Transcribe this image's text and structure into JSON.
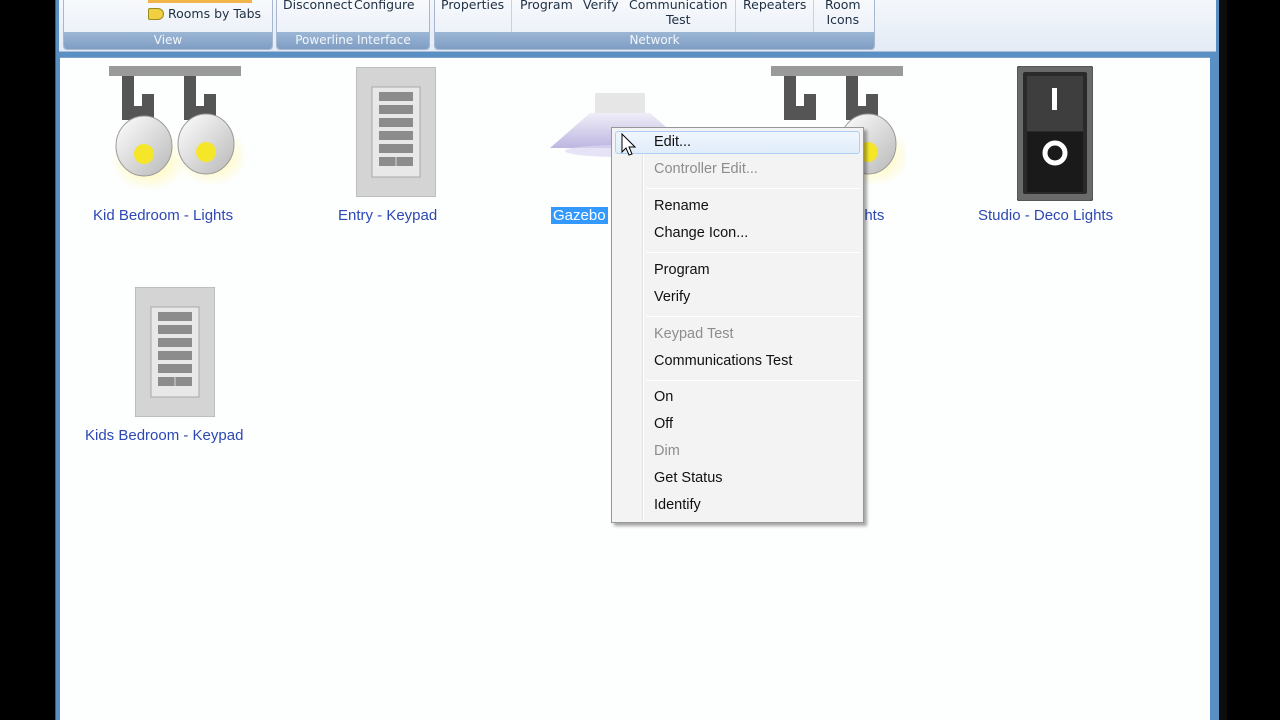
{
  "ribbon": {
    "view": {
      "rooms_by_tabs": "Rooms by Tabs",
      "group_label": "View"
    },
    "powerline": {
      "disconnect": "Disconnect",
      "configure": "Configure",
      "group_label": "Powerline Interface"
    },
    "network": {
      "properties": "Properties",
      "program": "Program",
      "verify": "Verify",
      "communication_l1": "Communication",
      "communication_l2": "Test",
      "repeaters": "Repeaters",
      "room_l1": "Room",
      "room_l2": "Icons",
      "group_label": "Network"
    }
  },
  "devices": [
    {
      "label": "Kid Bedroom - Lights",
      "icon": "track-light-icon"
    },
    {
      "label": "Entry - Keypad",
      "icon": "keypad-icon"
    },
    {
      "label": "Gazebo",
      "icon": "pendant-light-icon",
      "selected": true
    },
    {
      "label": "ghts",
      "icon": "track-light-icon"
    },
    {
      "label": "Studio - Deco Lights",
      "icon": "rocker-switch-icon"
    },
    {
      "label": "Kids Bedroom - Keypad",
      "icon": "keypad-icon"
    }
  ],
  "context_menu": {
    "items": [
      {
        "label": "Edit...",
        "enabled": true,
        "highlighted": true
      },
      {
        "label": "Controller Edit...",
        "enabled": false
      },
      {
        "label": "Rename",
        "enabled": true
      },
      {
        "label": "Change Icon...",
        "enabled": true
      },
      {
        "label": "Program",
        "enabled": true
      },
      {
        "label": "Verify",
        "enabled": true
      },
      {
        "label": "Keypad Test",
        "enabled": false
      },
      {
        "label": "Communications Test",
        "enabled": true
      },
      {
        "label": "On",
        "enabled": true
      },
      {
        "label": "Off",
        "enabled": true
      },
      {
        "label": "Dim",
        "enabled": false
      },
      {
        "label": "Get Status",
        "enabled": true
      },
      {
        "label": "Identify",
        "enabled": true
      }
    ]
  },
  "colors": {
    "device_label": "#2d48b4",
    "selection": "#3399ff",
    "group_label_bg": "#7f9ec4"
  }
}
